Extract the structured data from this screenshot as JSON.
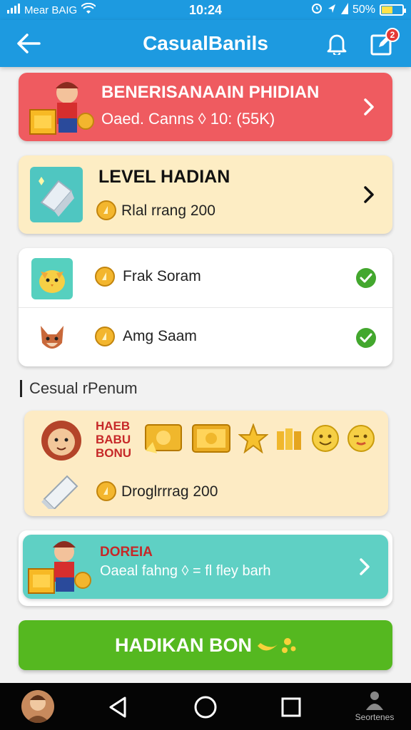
{
  "status": {
    "carrier": "Mear BAIG",
    "time": "10:24",
    "battery": "50%"
  },
  "appbar": {
    "title": "CasualBanils"
  },
  "badge": {
    "count": "2"
  },
  "card_rewards": {
    "title": "BENERISANAAIN PHIDIAN",
    "subtitle": "Oaed. Canns ◊ 10: (55K)"
  },
  "card_level": {
    "title": "LEVEL HADIAN",
    "subtitle": "Rlal rrang 200"
  },
  "tasks": [
    {
      "label": "Frak Soram",
      "done": true
    },
    {
      "label": "Amg Saam",
      "done": true
    }
  ],
  "section": {
    "title": "Cesual rPenum"
  },
  "bonus_card": {
    "badge_text": [
      "HAEB",
      "BABU",
      "BONU"
    ],
    "subtitle": "Droglrrrag 200"
  },
  "promo_card": {
    "title": "DOREIA",
    "subtitle": "Oaeal fahng ◊ = fl fley barh"
  },
  "cta": {
    "label": "HADIKAN BON"
  },
  "navbar": {
    "store_label": "Seortenes"
  },
  "colors": {
    "primary": "#1d9ae0",
    "card_red": "#ef5b60",
    "card_cream": "#fdedc4",
    "card_teal": "#5fd0c4",
    "cta_green": "#55b820",
    "check_green": "#43a72e",
    "coin": "#f3b62e"
  }
}
